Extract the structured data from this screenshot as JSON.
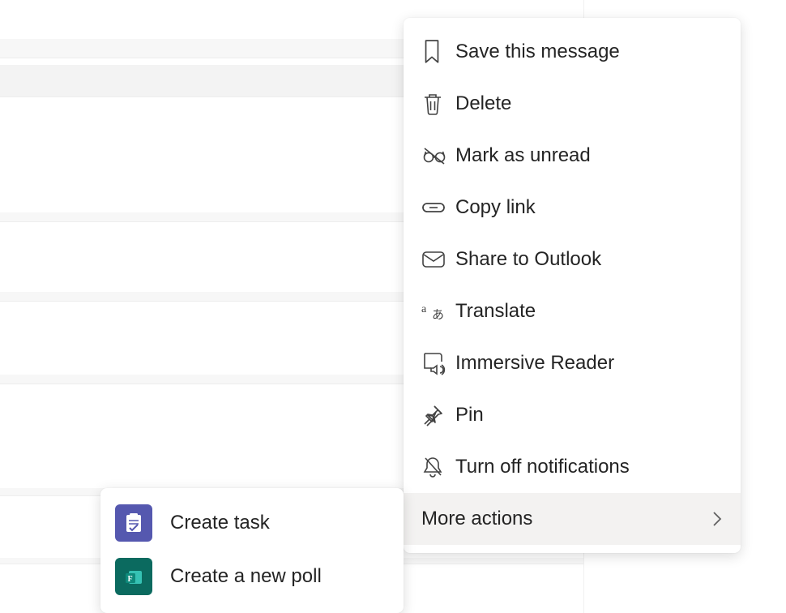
{
  "menu": {
    "items": [
      {
        "icon": "bookmark-icon",
        "label": "Save this message"
      },
      {
        "icon": "trash-icon",
        "label": "Delete"
      },
      {
        "icon": "glasses-off-icon",
        "label": "Mark as unread"
      },
      {
        "icon": "link-icon",
        "label": "Copy link"
      },
      {
        "icon": "envelope-icon",
        "label": "Share to Outlook"
      },
      {
        "icon": "translate-icon",
        "label": "Translate"
      },
      {
        "icon": "immersive-reader-icon",
        "label": "Immersive Reader"
      },
      {
        "icon": "pin-icon",
        "label": "Pin"
      },
      {
        "icon": "bell-off-icon",
        "label": "Turn off notifications"
      }
    ],
    "more_actions_label": "More actions"
  },
  "submenu": {
    "items": [
      {
        "icon": "tasks-app-icon",
        "label": "Create task"
      },
      {
        "icon": "forms-app-icon",
        "label": "Create a new poll"
      }
    ]
  }
}
